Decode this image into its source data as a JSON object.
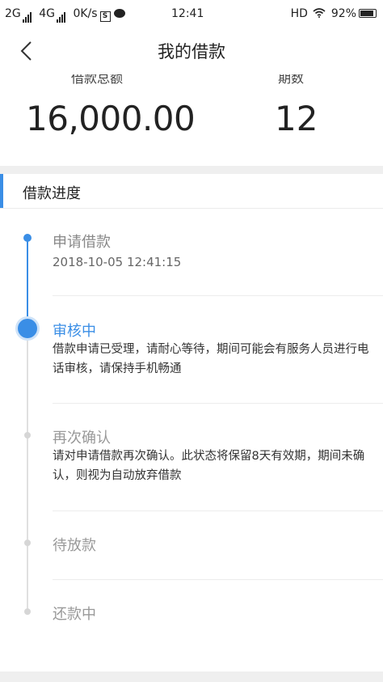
{
  "status_bar": {
    "network1": "2G",
    "network2": "4G",
    "speed": "0K/s",
    "time": "12:41",
    "hd": "HD",
    "battery": "92%"
  },
  "nav": {
    "title": "我的借款"
  },
  "summary": {
    "amount_label": "借款总额",
    "amount": "16,000.00",
    "term_label": "期数",
    "term": "12"
  },
  "section": {
    "title": "借款进度"
  },
  "steps": [
    {
      "title": "申请借款",
      "time": "2018-10-05 12:41:15",
      "status": "done"
    },
    {
      "title": "审核中",
      "desc": "借款申请已受理，请耐心等待，期间可能会有服务人员进行电话审核，请保持手机畅通",
      "status": "current"
    },
    {
      "title": "再次确认",
      "desc": "请对申请借款再次确认。此状态将保留8天有效期，期间未确认，则视为自动放弃借款",
      "status": "pending"
    },
    {
      "title": "待放款",
      "status": "pending"
    },
    {
      "title": "还款中",
      "status": "pending"
    }
  ],
  "colors": {
    "accent": "#3a8ee6",
    "pending_text": "#999999",
    "done_text": "#888888"
  }
}
